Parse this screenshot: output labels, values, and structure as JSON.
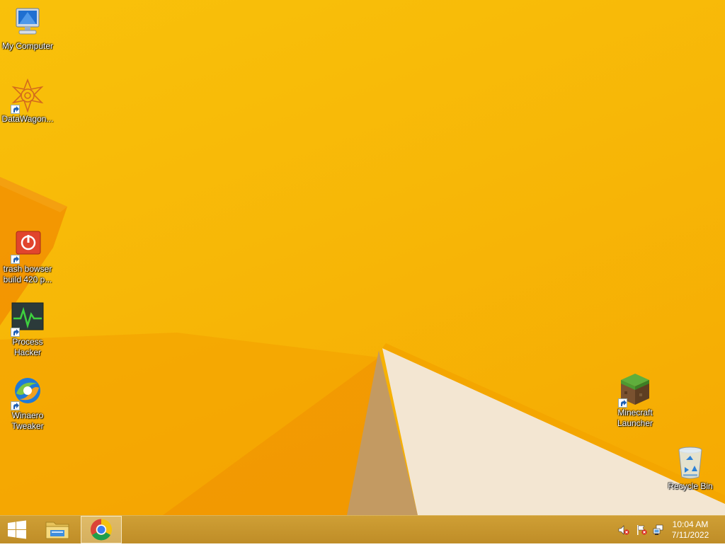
{
  "desktop": {
    "icons": [
      {
        "label": "My Computer",
        "icon": "my-computer-icon",
        "shortcut": false
      },
      {
        "label": "DataWagon...",
        "icon": "datawagon-icon",
        "shortcut": true
      },
      {
        "label": "trash bowser build 420 p...",
        "icon": "trash-bowser-icon",
        "shortcut": true
      },
      {
        "label": "Process Hacker",
        "icon": "process-hacker-icon",
        "shortcut": true
      },
      {
        "label": "Winaero Tweaker",
        "icon": "winaero-tweaker-icon",
        "shortcut": true
      },
      {
        "label": "Minecraft Launcher",
        "icon": "minecraft-launcher-icon",
        "shortcut": true
      },
      {
        "label": "Recycle Bin",
        "icon": "recycle-bin-icon",
        "shortcut": false
      }
    ]
  },
  "taskbar": {
    "pinned": [
      {
        "name": "start-button",
        "icon": "windows-logo-icon"
      },
      {
        "name": "file-explorer-button",
        "icon": "folder-icon"
      },
      {
        "name": "chrome-button",
        "icon": "chrome-icon",
        "active": true
      }
    ],
    "tray": {
      "icons": [
        "volume-muted-icon",
        "action-center-flag-icon",
        "network-icon"
      ],
      "time": "10:04 AM",
      "date": "7/11/2022"
    }
  },
  "colors": {
    "wallpaper": "#f7b707",
    "wallpaper_dark": "#f08a00",
    "paper": "#f6ead8",
    "taskbar": "#c7962d"
  }
}
